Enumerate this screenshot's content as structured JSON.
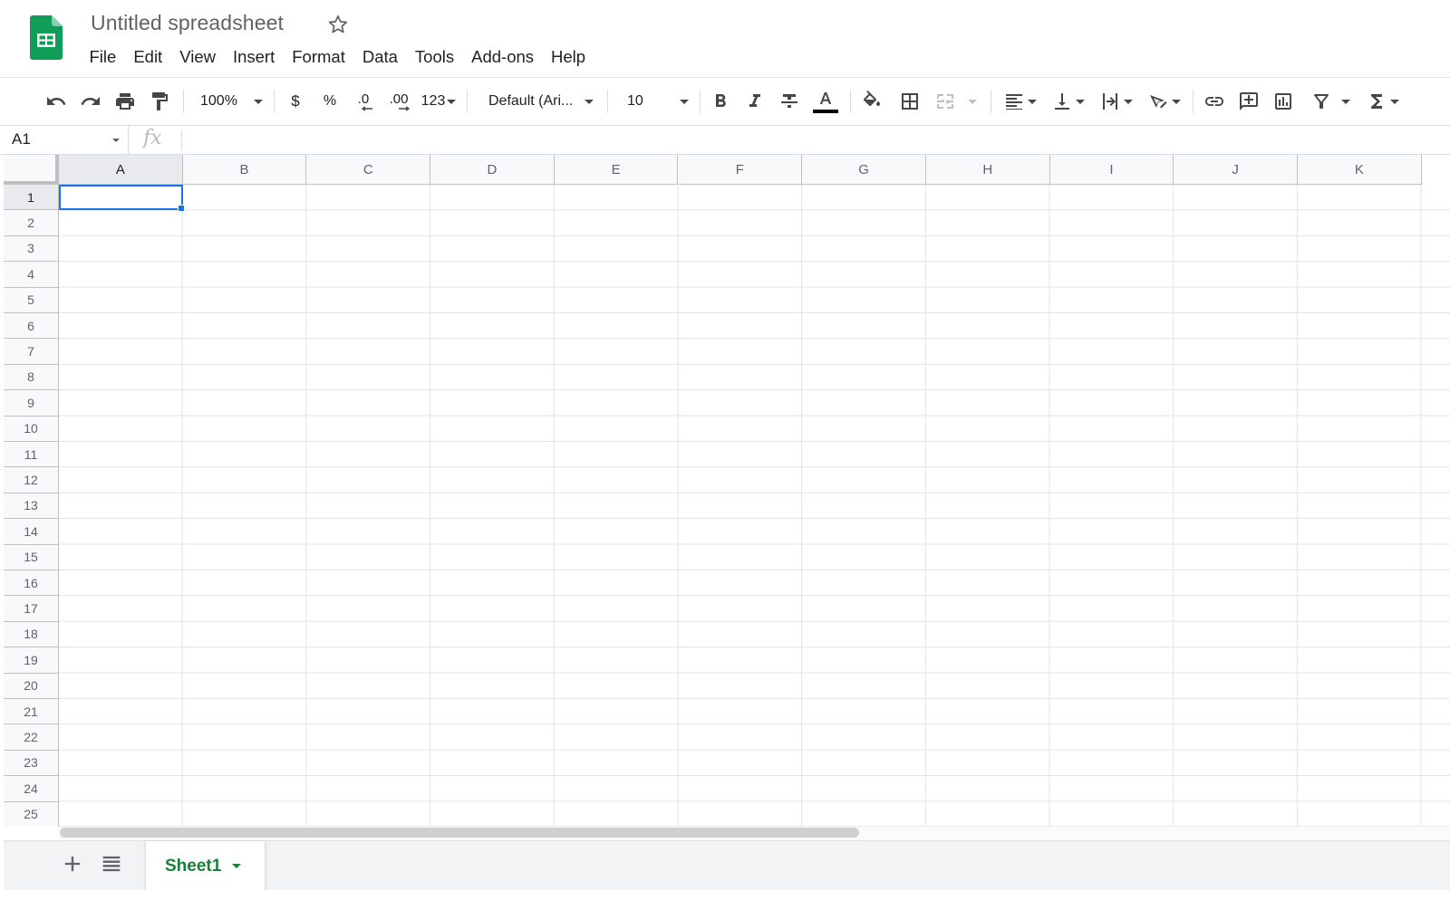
{
  "app": {
    "title": "Untitled spreadsheet",
    "brand_color": "#0f9d58",
    "icons": [
      "sheets-logo",
      "star-icon"
    ]
  },
  "menu": {
    "items": [
      "File",
      "Edit",
      "View",
      "Insert",
      "Format",
      "Data",
      "Tools",
      "Add-ons",
      "Help"
    ]
  },
  "toolbar": {
    "zoom": "100%",
    "currency_label": "$",
    "percent_label": "%",
    "decrease_decimal_label": ".0",
    "increase_decimal_label": ".00",
    "more_formats_label": "123",
    "font_family": "Default (Ari...",
    "font_size": "10",
    "text_color": "#000000",
    "icons": [
      "undo-icon",
      "redo-icon",
      "print-icon",
      "paint-format-icon",
      "bold-icon",
      "italic-icon",
      "strikethrough-icon",
      "text-color-icon",
      "fill-color-icon",
      "borders-icon",
      "merge-cells-icon",
      "horizontal-align-icon",
      "vertical-align-icon",
      "text-wrapping-icon",
      "text-rotation-icon",
      "insert-link-icon",
      "insert-comment-icon",
      "insert-chart-icon",
      "filter-icon",
      "functions-icon"
    ]
  },
  "formula_bar": {
    "name_box": "A1",
    "fx_label": "fx",
    "formula": ""
  },
  "grid": {
    "columns": [
      "A",
      "B",
      "C",
      "D",
      "E",
      "F",
      "G",
      "H",
      "I",
      "J",
      "K"
    ],
    "rows": [
      "1",
      "2",
      "3",
      "4",
      "5",
      "6",
      "7",
      "8",
      "9",
      "10",
      "11",
      "12",
      "13",
      "14",
      "15",
      "16",
      "17",
      "18",
      "19",
      "20",
      "21",
      "22",
      "23",
      "24",
      "25"
    ],
    "selected_cell": "A1",
    "selection_color": "#1a73e8"
  },
  "sheets": {
    "tabs": [
      "Sheet1"
    ],
    "active": "Sheet1",
    "active_color": "#188038"
  }
}
